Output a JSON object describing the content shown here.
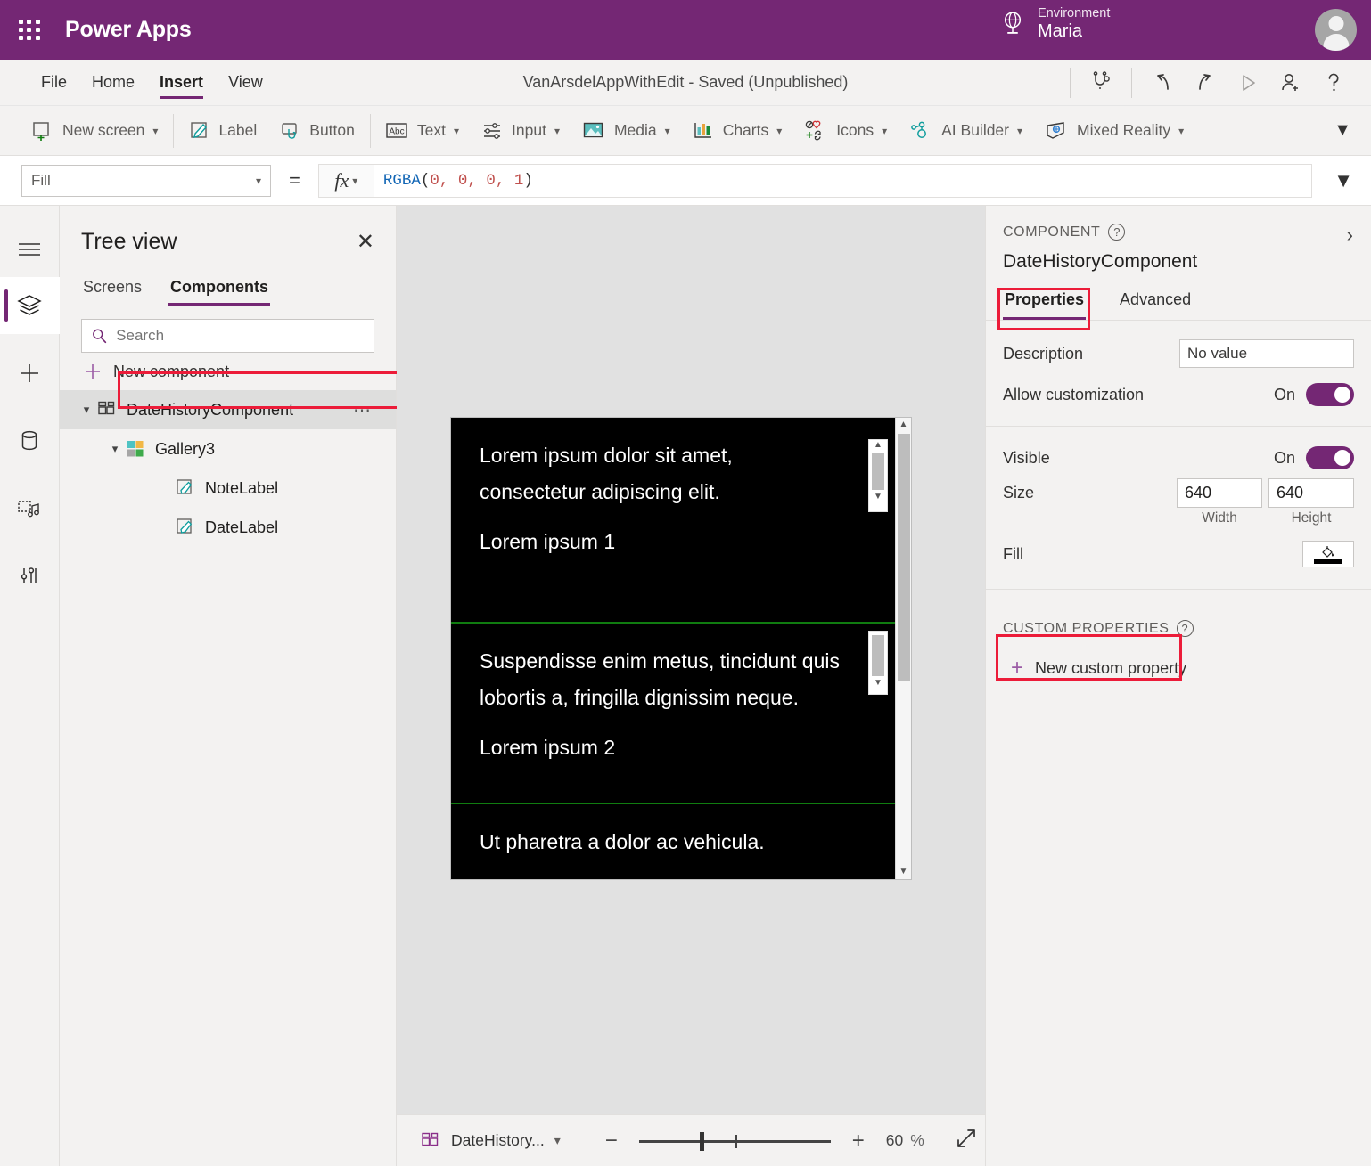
{
  "topbar": {
    "brand": "Power Apps",
    "waffle_icon": "app-launcher-icon",
    "environment_label": "Environment",
    "environment_name": "Maria",
    "globe_icon": "globe-icon",
    "avatar_icon": "user-avatar"
  },
  "menubar": {
    "items": [
      {
        "label": "File",
        "active": false
      },
      {
        "label": "Home",
        "active": false
      },
      {
        "label": "Insert",
        "active": true
      },
      {
        "label": "View",
        "active": false
      }
    ],
    "doc_title": "VanArsdelAppWithEdit - Saved (Unpublished)",
    "icons": [
      "app-checker-icon",
      "undo-icon",
      "redo-icon",
      "play-preview-icon",
      "share-icon",
      "help-icon"
    ]
  },
  "ribbon": {
    "items": [
      {
        "label": "New screen",
        "icon": "new-screen-icon",
        "chevron": true
      },
      {
        "label": "Label",
        "icon": "label-icon",
        "chevron": false
      },
      {
        "label": "Button",
        "icon": "button-icon",
        "chevron": false
      },
      {
        "label": "Text",
        "icon": "text-abc-icon",
        "chevron": true
      },
      {
        "label": "Input",
        "icon": "input-sliders-icon",
        "chevron": true
      },
      {
        "label": "Media",
        "icon": "media-image-icon",
        "chevron": true
      },
      {
        "label": "Charts",
        "icon": "charts-bar-icon",
        "chevron": true
      },
      {
        "label": "Icons",
        "icon": "icons-shapes-icon",
        "chevron": true
      },
      {
        "label": "AI Builder",
        "icon": "ai-builder-icon",
        "chevron": true
      },
      {
        "label": "Mixed Reality",
        "icon": "mixed-reality-icon",
        "chevron": true
      }
    ],
    "expand_icon": "chevron-down-icon"
  },
  "formulabar": {
    "property": "Fill",
    "equals": "=",
    "fx_icon": "fx-icon",
    "formula_fn": "RGBA",
    "formula_args": "0, 0, 0, 1",
    "formula_full": "RGBA(0, 0, 0, 1)",
    "expand_icon": "chevron-down-icon"
  },
  "rail": {
    "items": [
      {
        "name": "hamburger-menu-icon",
        "selected": false
      },
      {
        "name": "tree-view-layers-icon",
        "selected": true
      },
      {
        "name": "insert-plus-icon",
        "selected": false
      },
      {
        "name": "data-database-icon",
        "selected": false
      },
      {
        "name": "media-library-icon",
        "selected": false
      },
      {
        "name": "advanced-tools-icon",
        "selected": false
      }
    ]
  },
  "treeview": {
    "title": "Tree view",
    "close_icon": "close-icon",
    "tabs": [
      {
        "label": "Screens",
        "active": false
      },
      {
        "label": "Components",
        "active": true
      }
    ],
    "search_placeholder": "Search",
    "search_value": "",
    "search_icon": "search-icon",
    "new_component": "New component",
    "new_component_icon": "plus-icon",
    "overflow_icon": "...",
    "nodes": [
      {
        "label": "DateHistoryComponent",
        "icon": "component-icon",
        "depth": 0,
        "expanded": true,
        "selected": true,
        "highlighted": true
      },
      {
        "label": "Gallery3",
        "icon": "gallery-icon",
        "depth": 1,
        "expanded": true,
        "selected": false,
        "highlighted": false
      },
      {
        "label": "NoteLabel",
        "icon": "label-icon",
        "depth": 2,
        "expanded": false,
        "selected": false,
        "highlighted": false
      },
      {
        "label": "DateLabel",
        "icon": "label-icon",
        "depth": 2,
        "expanded": false,
        "selected": false,
        "highlighted": false
      }
    ]
  },
  "canvas": {
    "gallery_items": [
      {
        "note": "Lorem ipsum dolor sit amet, consectetur adipiscing elit.",
        "date": "Lorem ipsum 1"
      },
      {
        "note": "Suspendisse enim metus, tincidunt quis lobortis a, fringilla dignissim neque.",
        "date": "Lorem ipsum 2"
      },
      {
        "note": "Ut pharetra a dolor ac vehicula.",
        "date": ""
      }
    ],
    "fill_color": "#000000",
    "separator_color": "#107c10",
    "text_color": "#ffffff"
  },
  "statusbar": {
    "component_name": "DateHistory...",
    "component_icon": "component-icon",
    "chevron_icon": "chevron-down-icon",
    "zoom_out_icon": "minus-icon",
    "zoom_in_icon": "plus-icon",
    "zoom_value": "60",
    "zoom_unit": "%",
    "fullscreen_icon": "fit-screen-icon"
  },
  "rightpanel": {
    "kicker": "COMPONENT",
    "help_icon": "help-circle-icon",
    "collapse_icon": "chevron-right-icon",
    "component_name": "DateHistoryComponent",
    "tabs": [
      {
        "label": "Properties",
        "active": true,
        "highlighted": true
      },
      {
        "label": "Advanced",
        "active": false,
        "highlighted": false
      }
    ],
    "description_label": "Description",
    "description_value": "No value",
    "allow_customization_label": "Allow customization",
    "allow_customization_state": "On",
    "visible_label": "Visible",
    "visible_state": "On",
    "size_label": "Size",
    "size_width": "640",
    "size_height": "640",
    "width_caption": "Width",
    "height_caption": "Height",
    "fill_label": "Fill",
    "fill_icon": "paint-bucket-icon",
    "fill_swatch": "#000000",
    "custom_properties_title": "CUSTOM PROPERTIES",
    "custom_properties_help_icon": "help-circle-icon",
    "new_custom_property": "New custom property",
    "new_custom_property_icon": "plus-icon"
  },
  "colors": {
    "brand_purple": "#742774",
    "accent_purple": "#8a2f8a",
    "highlight_red": "#ec1c39",
    "canvas_bg": "#e1e1e1",
    "panel_bg": "#f3f2f1",
    "green_separator": "#107c10"
  }
}
